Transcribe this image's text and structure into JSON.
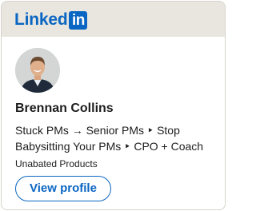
{
  "header": {
    "logo_text": "Linked",
    "logo_box_text": "in"
  },
  "profile": {
    "name": "Brennan Collins",
    "headline": "Stuck PMs → Senior PMs ‣ Stop Babysitting Your PMs ‣ CPO + Coach",
    "company": "Unabated Products"
  },
  "actions": {
    "view_profile_label": "View profile"
  },
  "colors": {
    "brand": "#0a66c2",
    "header_bg": "#e9e6df",
    "text": "#1d1d1d",
    "border": "#d6d3cc"
  }
}
